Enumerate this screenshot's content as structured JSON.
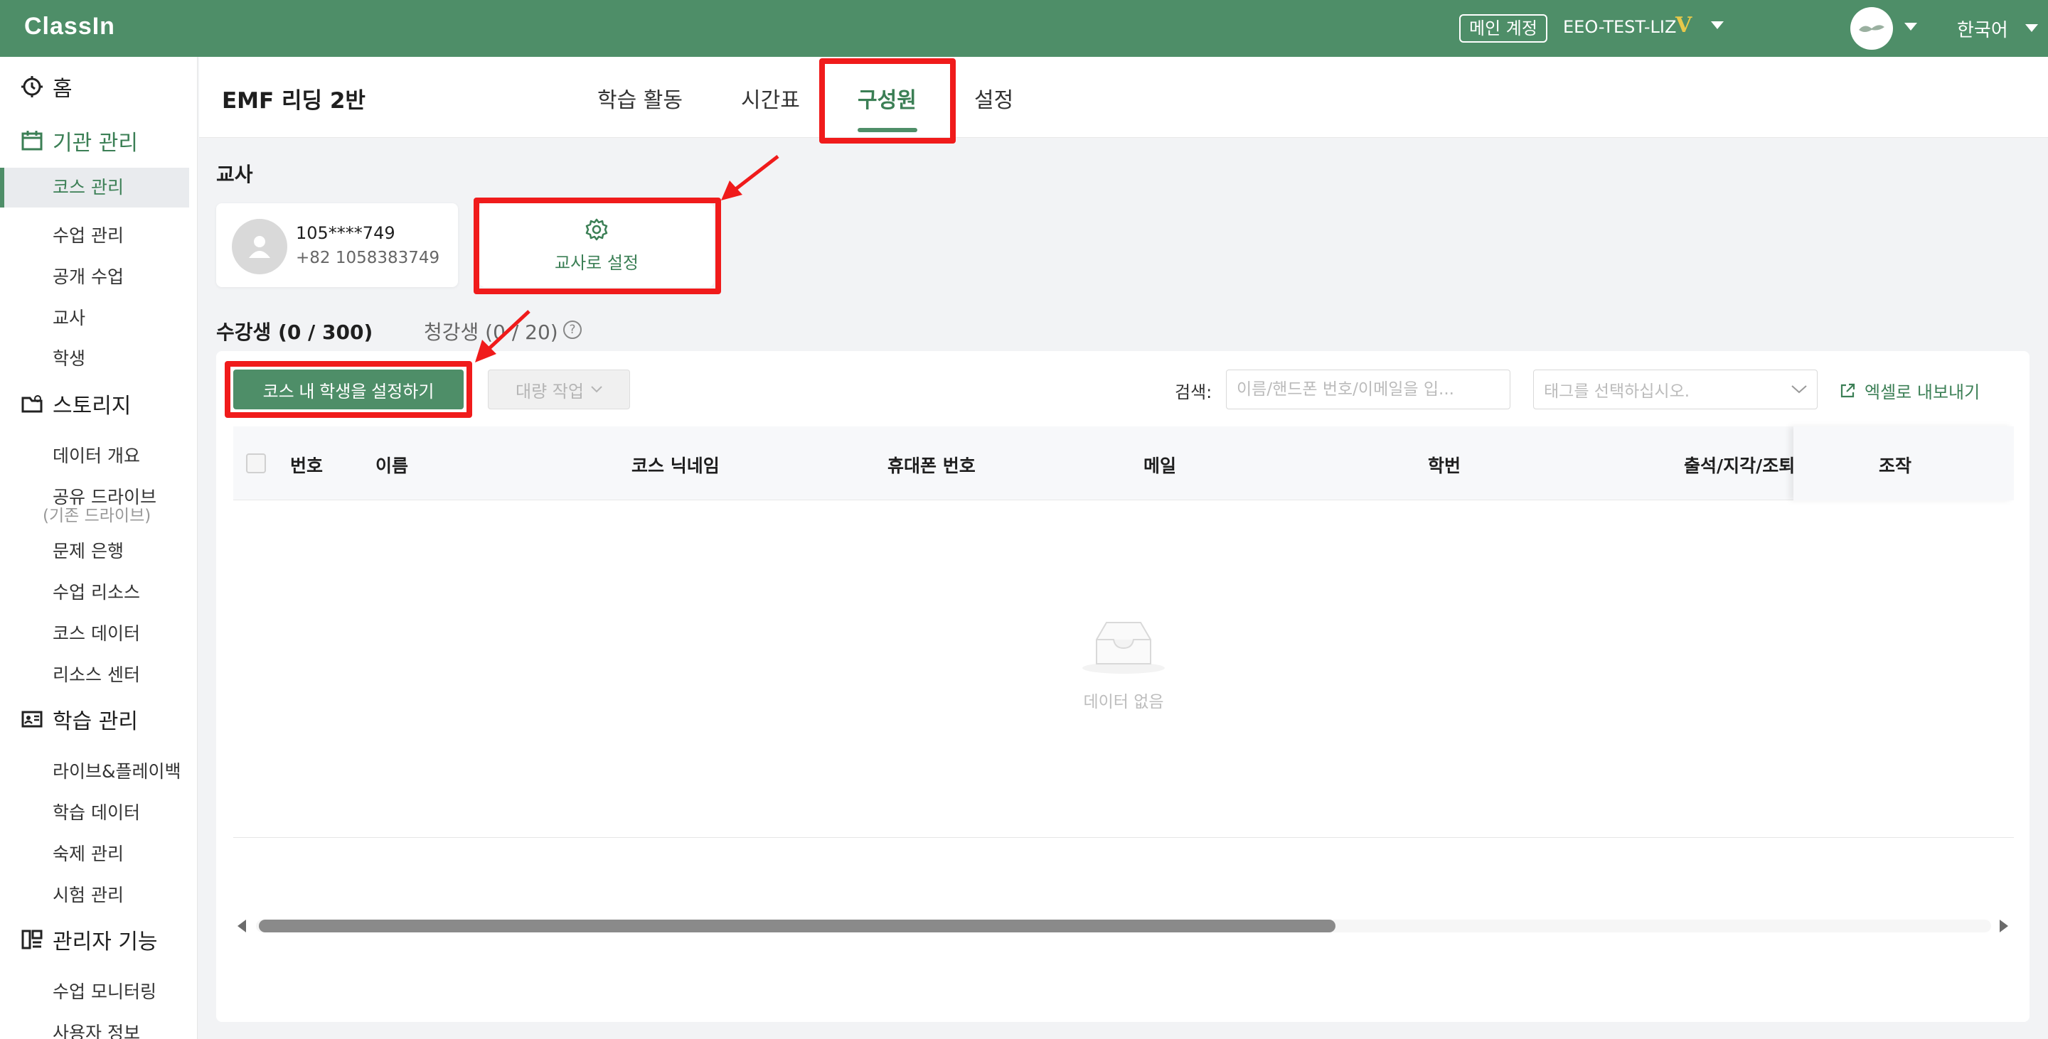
{
  "topbar": {
    "logo": "ClassIn",
    "main_account_label": "메인 계정",
    "account_name": "EEO-TEST-LIZ",
    "vip_badge": "V",
    "language": "한국어"
  },
  "sidebar": {
    "home": "홈",
    "org_group": "기관 관리",
    "org_items": [
      "코스 관리",
      "수업 관리",
      "공개 수업",
      "교사",
      "학생"
    ],
    "storage_group": "스토리지",
    "storage_items": [
      "데이터 개요",
      "공유 드라이브",
      "문제 은행",
      "수업 리소스",
      "코스 데이터",
      "리소스 센터"
    ],
    "shared_drive_sub": "(기존 드라이브)",
    "learning_group": "학습 관리",
    "learning_items": [
      "라이브&플레이백",
      "학습 데이터",
      "숙제 관리",
      "시험 관리"
    ],
    "admin_group": "관리자 기능",
    "admin_items": [
      "수업 모니터링",
      "사용자 정보"
    ]
  },
  "header": {
    "course_title": "EMF 리딩 2반",
    "tabs": [
      "학습 활동",
      "시간표",
      "구성원",
      "설정"
    ],
    "active_tab": "구성원"
  },
  "teacher": {
    "section_label": "교사",
    "id": "105****749",
    "phone": "+82 1058383749",
    "set_teacher_label": "교사로 설정"
  },
  "students": {
    "enrolled_label": "수강생 (0 / 300)",
    "auditor_label": "청강생 (0 / 20)",
    "set_button": "코스 내 학생을 설정하기",
    "bulk_button": "대량 작업",
    "search_label": "검색:",
    "search_placeholder": "이름/핸드폰 번호/이메일을 입...",
    "tag_placeholder": "태그를 선택하십시오.",
    "export_label": "엑셀로 내보내기",
    "columns": [
      "번호",
      "이름",
      "코스 닉네임",
      "휴대폰 번호",
      "메일",
      "학번",
      "출석/지각/조퇴",
      "조작"
    ],
    "empty_text": "데이터 없음"
  },
  "colors": {
    "brand": "#4e8e68",
    "accent_text": "#3b7f55",
    "annotation": "#f01b1b"
  },
  "icons": {
    "home": "gear-clock-icon",
    "org": "calendar-icon",
    "storage": "folder-icon",
    "learning": "id-card-icon",
    "admin": "admin-panel-icon",
    "set_teacher": "gear-icon",
    "help": "question-icon",
    "export": "external-link-icon",
    "empty": "inbox-icon"
  }
}
